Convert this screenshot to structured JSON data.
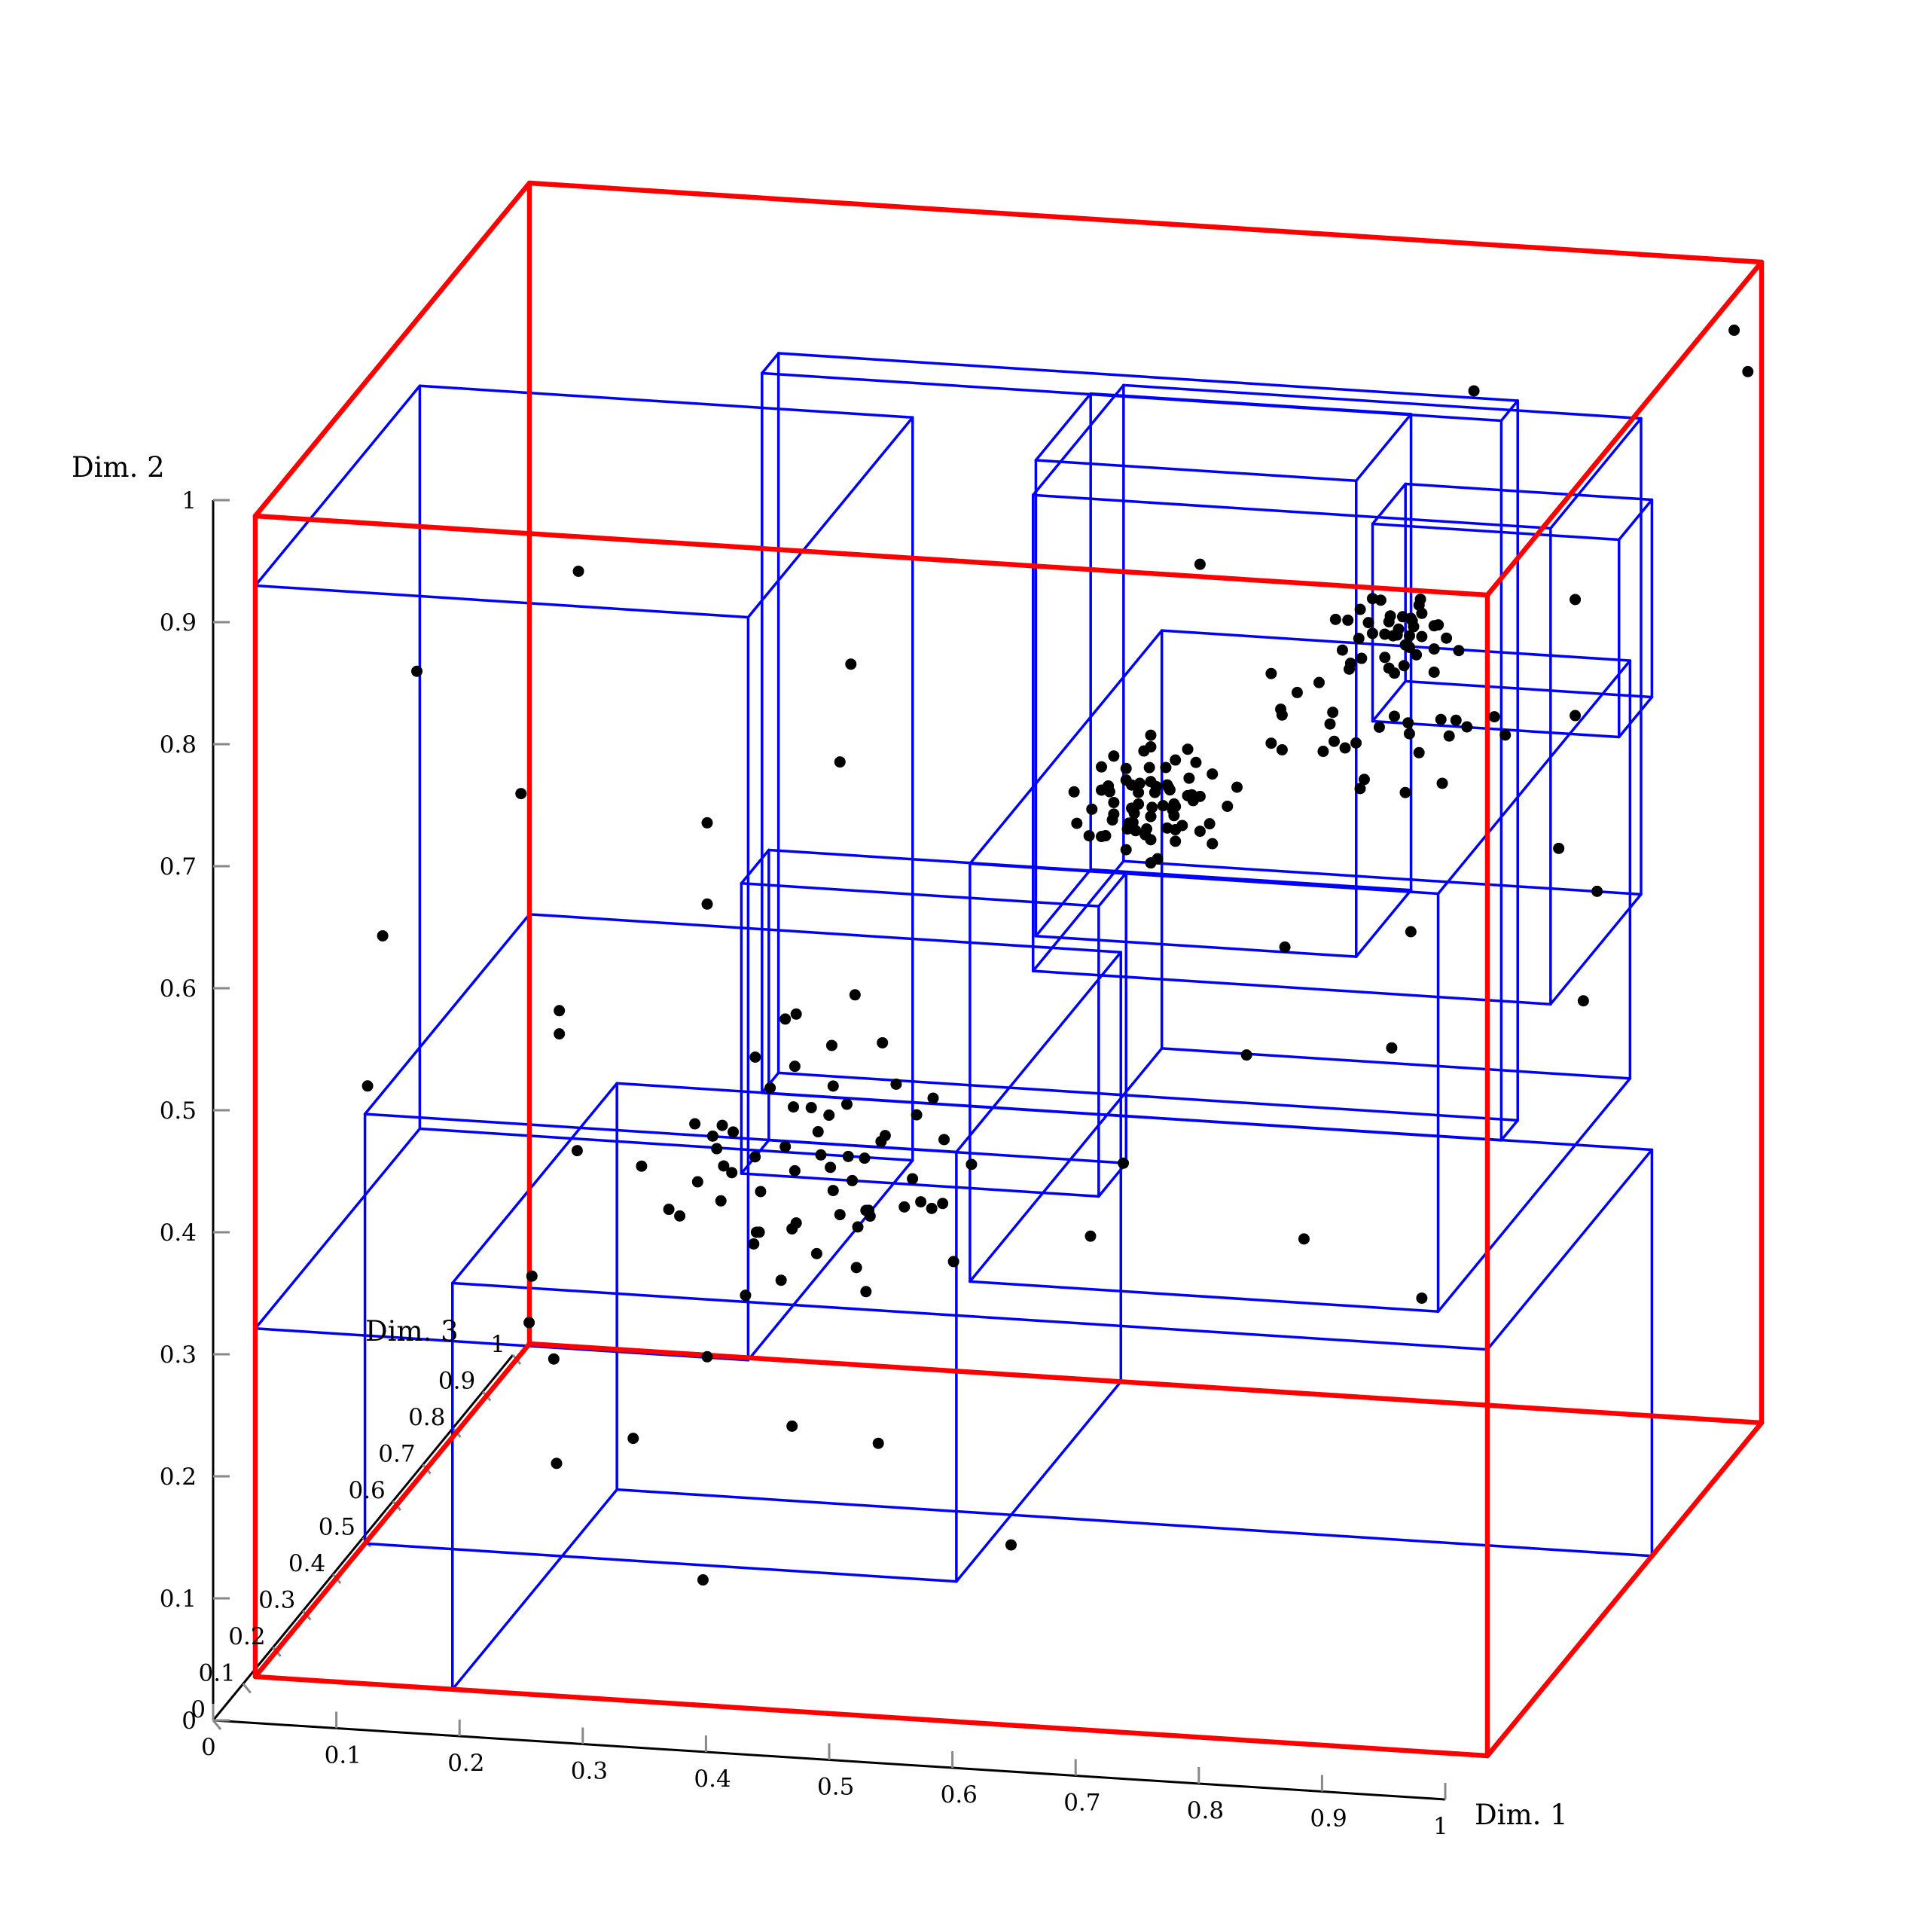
{
  "chart_data": {
    "type": "scatter",
    "subtype": "3d-scatter-with-bounding-boxes",
    "title": "",
    "axes": {
      "x": {
        "label": "Dim. 1",
        "range": [
          0,
          1
        ],
        "ticks": [
          "0",
          "0.1",
          "0.2",
          "0.3",
          "0.4",
          "0.5",
          "0.6",
          "0.7",
          "0.8",
          "0.9",
          "1"
        ]
      },
      "y": {
        "label": "Dim. 2",
        "range": [
          0,
          1
        ],
        "ticks": [
          "0",
          "0.1",
          "0.2",
          "0.3",
          "0.4",
          "0.5",
          "0.6",
          "0.7",
          "0.8",
          "0.9",
          "1"
        ]
      },
      "z": {
        "label": "Dim. 3",
        "range": [
          0,
          1
        ],
        "ticks": [
          "0",
          "0.1",
          "0.2",
          "0.3",
          "0.4",
          "0.5",
          "0.6",
          "0.7",
          "0.8",
          "0.9",
          "1"
        ]
      }
    },
    "grid": false,
    "legend": "none",
    "colors": {
      "outer_box": "#ff0000",
      "inner_boxes": "#0000ff",
      "points": "#000000",
      "axes": "#000000"
    },
    "outer_box": {
      "x": [
        0.0,
        1.0
      ],
      "y": [
        0.0,
        1.0
      ],
      "z": [
        0.0,
        1.0
      ]
    },
    "boxes": [
      {
        "x": [
          0.0,
          0.4
        ],
        "y": [
          0.3,
          0.94
        ],
        "z": [
          0.0,
          0.6
        ]
      },
      {
        "x": [
          0.16,
          1.0
        ],
        "y": [
          0.0,
          0.35
        ],
        "z": [
          0.0,
          0.6
        ]
      },
      {
        "x": [
          0.0,
          0.48
        ],
        "y": [
          0.0,
          0.37
        ],
        "z": [
          0.4,
          1.0
        ]
      },
      {
        "x": [
          0.3,
          0.9
        ],
        "y": [
          0.38,
          1.0
        ],
        "z": [
          0.5,
          0.56
        ]
      },
      {
        "x": [
          0.35,
          0.64
        ],
        "y": [
          0.4,
          0.65
        ],
        "z": [
          0.2,
          0.3
        ]
      },
      {
        "x": [
          0.5,
          0.76
        ],
        "y": [
          0.5,
          0.91
        ],
        "z": [
          0.6,
          0.8
        ]
      },
      {
        "x": [
          0.52,
          0.94
        ],
        "y": [
          0.5,
          0.91
        ],
        "z": [
          0.5,
          0.83
        ]
      },
      {
        "x": [
          0.58,
          0.96
        ],
        "y": [
          0.38,
          0.74
        ],
        "z": [
          0.0,
          0.7
        ]
      },
      {
        "x": [
          0.8,
          1.0
        ],
        "y": [
          0.74,
          0.91
        ],
        "z": [
          0.48,
          0.6
        ]
      }
    ],
    "points": [
      [
        0.24,
        0.94,
        0.1
      ],
      [
        0.86,
        1.0,
        0.58
      ],
      [
        0.7,
        0.92,
        0.3
      ],
      [
        0.12,
        0.86,
        0.05
      ],
      [
        0.45,
        0.86,
        0.15
      ],
      [
        0.43,
        0.76,
        0.2
      ],
      [
        0.07,
        0.6,
        0.15
      ],
      [
        0.16,
        0.7,
        0.25
      ],
      [
        0.08,
        0.5,
        0.05
      ],
      [
        0.18,
        0.5,
        0.3
      ],
      [
        0.18,
        0.48,
        0.3
      ],
      [
        0.3,
        0.67,
        0.3
      ],
      [
        0.3,
        0.6,
        0.3
      ],
      [
        0.42,
        0.53,
        0.3
      ],
      [
        0.96,
        0.75,
        0.5
      ],
      [
        1.0,
        0.97,
        0.9
      ],
      [
        0.98,
        0.68,
        0.35
      ],
      [
        1.0,
        0.63,
        0.4
      ],
      [
        1.0,
        0.55,
        0.35
      ],
      [
        0.78,
        0.61,
        0.25
      ],
      [
        0.76,
        0.53,
        0.2
      ],
      [
        0.86,
        0.6,
        0.35
      ],
      [
        0.86,
        0.52,
        0.28
      ],
      [
        0.88,
        0.3,
        0.3
      ],
      [
        0.84,
        0.42,
        0.05
      ],
      [
        0.66,
        0.43,
        0.2
      ],
      [
        0.5,
        0.42,
        0.15
      ],
      [
        0.54,
        0.36,
        0.12
      ],
      [
        0.6,
        0.32,
        0.35
      ],
      [
        0.36,
        0.34,
        0.2
      ],
      [
        0.44,
        0.4,
        0.2
      ],
      [
        0.2,
        0.14,
        0.2
      ],
      [
        0.38,
        0.17,
        0.25
      ],
      [
        0.45,
        0.16,
        0.25
      ],
      [
        0.58,
        0.11,
        0.15
      ],
      [
        0.35,
        0.09,
        0.06
      ],
      [
        0.28,
        0.19,
        0.12
      ],
      [
        0.3,
        0.21,
        0.3
      ],
      [
        0.32,
        0.25,
        0.35
      ],
      [
        0.26,
        0.34,
        0.5
      ],
      [
        0.28,
        0.33,
        0.45
      ],
      [
        0.25,
        0.35,
        0.7
      ],
      [
        0.27,
        0.33,
        0.4
      ],
      [
        0.38,
        0.33,
        0.4
      ],
      [
        0.41,
        0.31,
        0.4
      ],
      [
        0.47,
        0.33,
        0.5
      ],
      [
        1.0,
        0.92,
        0.95
      ],
      [
        0.96,
        0.85,
        0.5
      ],
      [
        0.15,
        0.32,
        0.5
      ],
      [
        0.18,
        0.28,
        0.6
      ],
      [
        0.18,
        0.3,
        0.2
      ],
      [
        0.22,
        0.26,
        0.1
      ],
      [
        0.2,
        0.29,
        0.1
      ],
      [
        0.66,
        0.73,
        0.3
      ],
      [
        0.67,
        0.72,
        0.32
      ],
      [
        0.65,
        0.7,
        0.28
      ],
      [
        0.68,
        0.71,
        0.3
      ],
      [
        0.64,
        0.72,
        0.32
      ],
      [
        0.69,
        0.7,
        0.28
      ],
      [
        0.63,
        0.71,
        0.3
      ],
      [
        0.66,
        0.74,
        0.26
      ],
      [
        0.67,
        0.69,
        0.34
      ],
      [
        0.65,
        0.71,
        0.3
      ],
      [
        0.66,
        0.7,
        0.3
      ],
      [
        0.68,
        0.73,
        0.28
      ],
      [
        0.64,
        0.7,
        0.32
      ],
      [
        0.67,
        0.72,
        0.26
      ],
      [
        0.62,
        0.72,
        0.3
      ],
      [
        0.7,
        0.72,
        0.3
      ],
      [
        0.66,
        0.68,
        0.3
      ],
      [
        0.66,
        0.76,
        0.3
      ],
      [
        0.69,
        0.74,
        0.33
      ],
      [
        0.63,
        0.69,
        0.27
      ],
      [
        0.65,
        0.73,
        0.34
      ],
      [
        0.68,
        0.7,
        0.27
      ],
      [
        0.61,
        0.7,
        0.31
      ],
      [
        0.71,
        0.7,
        0.29
      ],
      [
        0.66,
        0.71,
        0.36
      ],
      [
        0.66,
        0.72,
        0.24
      ],
      [
        0.64,
        0.74,
        0.3
      ],
      [
        0.68,
        0.68,
        0.3
      ],
      [
        0.63,
        0.73,
        0.28
      ],
      [
        0.69,
        0.71,
        0.32
      ],
      [
        0.65,
        0.69,
        0.29
      ],
      [
        0.67,
        0.74,
        0.31
      ],
      [
        0.62,
        0.71,
        0.33
      ],
      [
        0.7,
        0.73,
        0.27
      ],
      [
        0.65,
        0.75,
        0.32
      ],
      [
        0.67,
        0.67,
        0.28
      ],
      [
        0.64,
        0.71,
        0.25
      ],
      [
        0.68,
        0.72,
        0.35
      ],
      [
        0.6,
        0.72,
        0.29
      ],
      [
        0.72,
        0.71,
        0.31
      ],
      [
        0.66,
        0.73,
        0.3
      ],
      [
        0.66,
        0.7,
        0.3
      ],
      [
        0.67,
        0.71,
        0.3
      ],
      [
        0.65,
        0.72,
        0.3
      ],
      [
        0.7,
        0.69,
        0.3
      ],
      [
        0.62,
        0.68,
        0.3
      ],
      [
        0.69,
        0.76,
        0.3
      ],
      [
        0.63,
        0.75,
        0.3
      ],
      [
        0.66,
        0.66,
        0.3
      ],
      [
        0.66,
        0.77,
        0.3
      ],
      [
        0.71,
        0.74,
        0.3
      ],
      [
        0.61,
        0.68,
        0.3
      ],
      [
        0.64,
        0.67,
        0.3
      ],
      [
        0.68,
        0.75,
        0.3
      ],
      [
        0.6,
        0.69,
        0.3
      ],
      [
        0.73,
        0.73,
        0.3
      ],
      [
        0.65,
        0.68,
        0.33
      ],
      [
        0.67,
        0.73,
        0.27
      ],
      [
        0.64,
        0.69,
        0.31
      ],
      [
        0.68,
        0.71,
        0.29
      ],
      [
        0.66,
        0.72,
        0.32
      ],
      [
        0.66,
        0.69,
        0.28
      ],
      [
        0.65,
        0.7,
        0.26
      ],
      [
        0.67,
        0.7,
        0.34
      ],
      [
        0.63,
        0.7,
        0.3
      ],
      [
        0.69,
        0.72,
        0.3
      ],
      [
        0.64,
        0.73,
        0.3
      ],
      [
        0.68,
        0.69,
        0.3
      ],
      [
        0.62,
        0.74,
        0.3
      ],
      [
        0.71,
        0.68,
        0.3
      ],
      [
        0.82,
        0.88,
        0.3
      ],
      [
        0.85,
        0.86,
        0.35
      ],
      [
        0.84,
        0.88,
        0.25
      ],
      [
        0.87,
        0.87,
        0.3
      ],
      [
        0.86,
        0.88,
        0.32
      ],
      [
        0.88,
        0.86,
        0.28
      ],
      [
        0.83,
        0.87,
        0.33
      ],
      [
        0.86,
        0.89,
        0.27
      ],
      [
        0.89,
        0.88,
        0.3
      ],
      [
        0.85,
        0.85,
        0.3
      ],
      [
        0.87,
        0.89,
        0.34
      ],
      [
        0.84,
        0.86,
        0.26
      ],
      [
        0.9,
        0.87,
        0.3
      ],
      [
        0.82,
        0.86,
        0.28
      ],
      [
        0.86,
        0.86,
        0.36
      ],
      [
        0.88,
        0.88,
        0.24
      ],
      [
        0.85,
        0.88,
        0.32
      ],
      [
        0.87,
        0.85,
        0.28
      ],
      [
        0.83,
        0.89,
        0.3
      ],
      [
        0.89,
        0.86,
        0.3
      ],
      [
        0.84,
        0.87,
        0.3
      ],
      [
        0.86,
        0.87,
        0.3
      ],
      [
        0.88,
        0.89,
        0.3
      ],
      [
        0.85,
        0.86,
        0.33
      ],
      [
        0.9,
        0.89,
        0.27
      ],
      [
        0.81,
        0.88,
        0.3
      ],
      [
        0.87,
        0.88,
        0.31
      ],
      [
        0.86,
        0.84,
        0.29
      ],
      [
        0.84,
        0.9,
        0.3
      ],
      [
        0.89,
        0.84,
        0.3
      ],
      [
        0.82,
        0.84,
        0.31
      ],
      [
        0.88,
        0.9,
        0.29
      ],
      [
        0.85,
        0.87,
        0.3
      ],
      [
        0.87,
        0.86,
        0.3
      ],
      [
        0.86,
        0.87,
        0.35
      ],
      [
        0.83,
        0.85,
        0.26
      ],
      [
        0.91,
        0.86,
        0.3
      ],
      [
        0.84,
        0.89,
        0.33
      ],
      [
        0.86,
        0.85,
        0.27
      ],
      [
        0.88,
        0.87,
        0.3
      ],
      [
        0.78,
        0.86,
        0.2
      ],
      [
        0.8,
        0.84,
        0.15
      ],
      [
        0.83,
        0.83,
        0.2
      ],
      [
        0.86,
        0.82,
        0.15
      ],
      [
        0.88,
        0.83,
        0.2
      ],
      [
        0.91,
        0.84,
        0.12
      ],
      [
        0.93,
        0.83,
        0.2
      ],
      [
        0.95,
        0.82,
        0.25
      ],
      [
        0.8,
        0.81,
        0.15
      ],
      [
        0.84,
        0.8,
        0.2
      ],
      [
        0.87,
        0.79,
        0.12
      ],
      [
        0.9,
        0.8,
        0.2
      ],
      [
        0.93,
        0.79,
        0.15
      ],
      [
        0.82,
        0.79,
        0.25
      ],
      [
        0.86,
        0.78,
        0.18
      ],
      [
        0.92,
        0.81,
        0.22
      ],
      [
        0.81,
        0.86,
        0.1
      ],
      [
        0.85,
        0.85,
        0.1
      ],
      [
        0.89,
        0.85,
        0.1
      ],
      [
        0.94,
        0.86,
        0.1
      ],
      [
        0.79,
        0.83,
        0.25
      ],
      [
        0.88,
        0.81,
        0.25
      ],
      [
        0.95,
        0.84,
        0.15
      ],
      [
        0.83,
        0.87,
        0.15
      ],
      [
        0.97,
        0.82,
        0.2
      ],
      [
        0.9,
        0.78,
        0.15
      ],
      [
        0.84,
        0.82,
        0.12
      ],
      [
        0.78,
        0.8,
        0.2
      ],
      [
        0.28,
        0.35,
        0.25
      ],
      [
        0.32,
        0.37,
        0.3
      ],
      [
        0.36,
        0.36,
        0.35
      ],
      [
        0.4,
        0.38,
        0.3
      ],
      [
        0.44,
        0.36,
        0.25
      ],
      [
        0.3,
        0.33,
        0.35
      ],
      [
        0.34,
        0.32,
        0.3
      ],
      [
        0.38,
        0.34,
        0.25
      ],
      [
        0.42,
        0.33,
        0.35
      ],
      [
        0.46,
        0.35,
        0.3
      ],
      [
        0.31,
        0.39,
        0.35
      ],
      [
        0.35,
        0.4,
        0.25
      ],
      [
        0.39,
        0.41,
        0.3
      ],
      [
        0.43,
        0.39,
        0.35
      ],
      [
        0.33,
        0.42,
        0.2
      ],
      [
        0.37,
        0.43,
        0.3
      ],
      [
        0.41,
        0.44,
        0.25
      ],
      [
        0.45,
        0.42,
        0.2
      ],
      [
        0.29,
        0.38,
        0.4
      ],
      [
        0.47,
        0.38,
        0.4
      ],
      [
        0.35,
        0.3,
        0.4
      ],
      [
        0.4,
        0.3,
        0.4
      ],
      [
        0.44,
        0.31,
        0.45
      ],
      [
        0.31,
        0.31,
        0.45
      ],
      [
        0.36,
        0.45,
        0.35
      ],
      [
        0.42,
        0.46,
        0.4
      ],
      [
        0.33,
        0.46,
        0.45
      ],
      [
        0.38,
        0.39,
        0.45
      ],
      [
        0.4,
        0.35,
        0.5
      ],
      [
        0.34,
        0.37,
        0.5
      ],
      [
        0.45,
        0.4,
        0.45
      ],
      [
        0.37,
        0.33,
        0.5
      ],
      [
        0.43,
        0.37,
        0.2
      ],
      [
        0.3,
        0.36,
        0.2
      ],
      [
        0.46,
        0.32,
        0.4
      ],
      [
        0.39,
        0.47,
        0.35
      ],
      [
        0.35,
        0.48,
        0.4
      ],
      [
        0.41,
        0.28,
        0.35
      ],
      [
        0.36,
        0.28,
        0.3
      ],
      [
        0.32,
        0.29,
        0.4
      ],
      [
        0.44,
        0.29,
        0.25
      ],
      [
        0.48,
        0.34,
        0.35
      ],
      [
        0.29,
        0.41,
        0.3
      ],
      [
        0.38,
        0.42,
        0.4
      ],
      [
        0.42,
        0.41,
        0.45
      ],
      [
        0.34,
        0.43,
        0.35
      ],
      [
        0.47,
        0.43,
        0.3
      ],
      [
        0.37,
        0.36,
        0.4
      ],
      [
        0.4,
        0.32,
        0.25
      ],
      [
        0.33,
        0.35,
        0.45
      ]
    ]
  }
}
